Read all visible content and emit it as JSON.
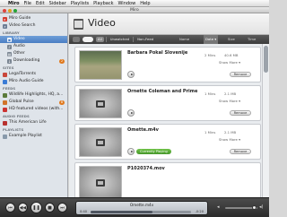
{
  "menubar": {
    "items": [
      "Miro",
      "File",
      "Edit",
      "Sidebar",
      "Playlists",
      "Playback",
      "Window",
      "Help"
    ]
  },
  "window": {
    "title": "Miro"
  },
  "sidebar": {
    "top_items": [
      {
        "label": "Miro Guide",
        "icon": "miro-guide-icon",
        "color": "#d43b2f"
      },
      {
        "label": "Video Search",
        "icon": "search-icon",
        "color": "#6b7d95"
      }
    ],
    "library_heading": "LIBRARY",
    "library_items": [
      {
        "label": "Video",
        "icon": "video-icon",
        "selected": true
      },
      {
        "label": "Audio",
        "icon": "audio-icon"
      },
      {
        "label": "Other",
        "icon": "other-icon"
      },
      {
        "label": "Downloading",
        "icon": "download-icon",
        "badge": "2"
      }
    ],
    "sites_heading": "SITES",
    "sites_items": [
      {
        "label": "LegalTorrents",
        "icon": "site-icon",
        "color": "#c9463b"
      },
      {
        "label": "Miro Audio Guide",
        "icon": "site-icon",
        "color": "#3a7bd5"
      }
    ],
    "feeds_heading": "FEEDS",
    "feeds_items": [
      {
        "label": "Wildlife Highlights, HQ, a...",
        "icon": "feed-icon",
        "color": "#5a7a3a"
      },
      {
        "label": "Global Pulse",
        "icon": "feed-icon",
        "color": "#d1742b",
        "badge": "8"
      },
      {
        "label": "HD featured videos (with...",
        "icon": "feed-icon",
        "color": "#c33"
      }
    ],
    "audio_feeds_heading": "AUDIO FEEDS",
    "audio_feeds_items": [
      {
        "label": "This American Life",
        "icon": "audio-feed-icon",
        "color": "#b8312f"
      }
    ],
    "playlists_heading": "PLAYLISTS",
    "playlists_items": [
      {
        "label": "Example Playlist",
        "icon": "playlist-icon",
        "color": "#8899aa"
      }
    ]
  },
  "main": {
    "title": "Video",
    "search_placeholder": "",
    "filters": [
      "All",
      "Unwatched",
      "Non-Feed"
    ],
    "sort_columns": [
      "Name",
      "Date",
      "Size",
      "Time"
    ],
    "active_sort": "Date"
  },
  "videos": [
    {
      "title": "Barbara Pokal Slovenije",
      "time": "2 Mins",
      "size": "40.6 MB",
      "show_more": "Show More",
      "remove": "Remove",
      "status": "",
      "thumb": "field"
    },
    {
      "title": "Ornette Coleman and Prime",
      "time": "1 Mins",
      "size": "2.1 MB",
      "show_more": "Show More",
      "remove": "Remove",
      "status": "",
      "thumb": "film"
    },
    {
      "title": "Omette.m4v",
      "time": "1 Mins",
      "size": "2.1 MB",
      "show_more": "Show More",
      "remove": "Remove",
      "status": "Currently Playing",
      "thumb": "film"
    },
    {
      "title": "P1020374.mov",
      "time": "",
      "size": "",
      "show_more": "",
      "remove": "",
      "status": "",
      "thumb": "film"
    }
  ],
  "player": {
    "now_playing": "Omette.m4v",
    "elapsed": "0:40",
    "remaining": "-0:20",
    "progress": 0.62,
    "volume": 0.9
  }
}
